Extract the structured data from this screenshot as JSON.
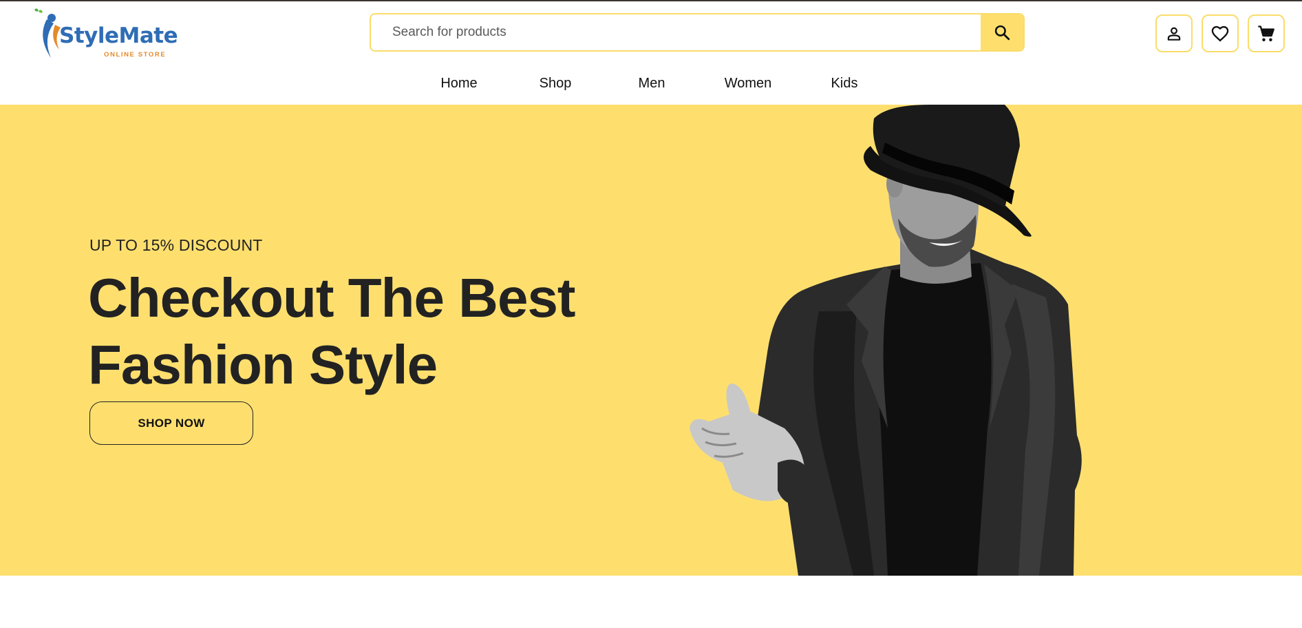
{
  "brand": {
    "name": "StyleMate",
    "tagline": "ONLINE STORE",
    "colors": {
      "blue": "#2f6db5",
      "orange": "#e58a2a",
      "green": "#4caf50"
    }
  },
  "search": {
    "placeholder": "Search for products",
    "value": "",
    "button_icon": "search-icon"
  },
  "header_actions": [
    {
      "icon": "account-icon"
    },
    {
      "icon": "heart-icon"
    },
    {
      "icon": "cart-icon"
    }
  ],
  "nav": {
    "items": [
      {
        "label": "Home"
      },
      {
        "label": "Shop"
      },
      {
        "label": "Men"
      },
      {
        "label": "Women"
      },
      {
        "label": "Kids"
      }
    ]
  },
  "hero": {
    "kicker": "UP TO 15% DISCOUNT",
    "headline_line1": "Checkout The Best",
    "headline_line2": "Fashion Style",
    "cta_label": "SHOP NOW",
    "image": "man-in-black-hat-and-blazer"
  },
  "colors": {
    "accent_yellow": "#fedf6e",
    "border_yellow": "#fadc6a",
    "text_dark": "#222222"
  }
}
